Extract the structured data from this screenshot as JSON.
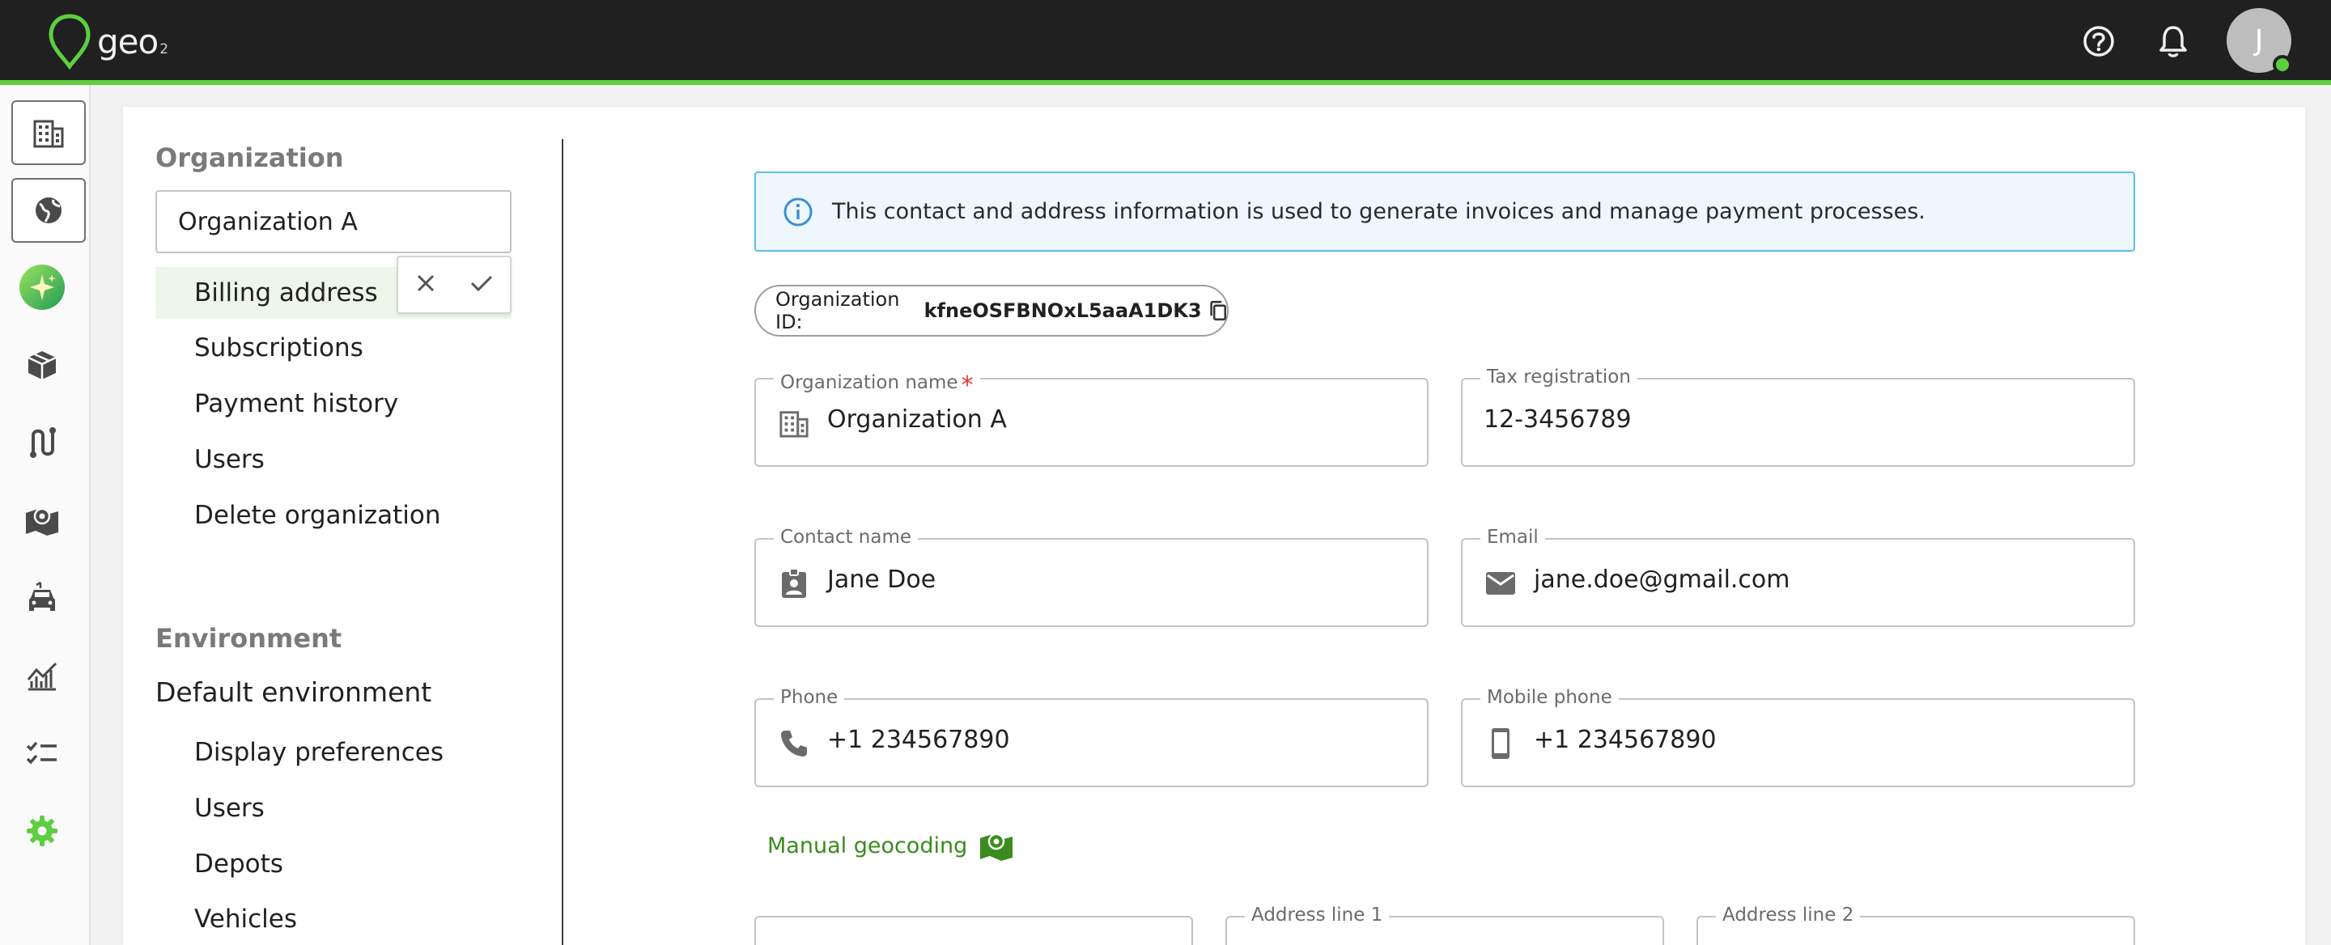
{
  "app": {
    "logo_text": "geo",
    "logo_sub": "2",
    "user_initial": "J"
  },
  "icons": {
    "help": "help-circle-icon",
    "notifications": "bell-icon"
  },
  "sidebar_rail": [
    "building-icon",
    "globe-icon",
    "sparkle-icon",
    "box-icon",
    "route-icon",
    "map-marker-icon",
    "car-icon",
    "analytics-icon",
    "checklist-icon",
    "gear-icon"
  ],
  "settings_nav": {
    "organization_heading": "Organization",
    "organization_select": "Organization A",
    "org_items": [
      "Billing address",
      "Subscriptions",
      "Payment history",
      "Users",
      "Delete organization"
    ],
    "environment_heading": "Environment",
    "environment_name": "Default environment",
    "env_items": [
      "Display preferences",
      "Users",
      "Depots",
      "Vehicles"
    ]
  },
  "content": {
    "info_banner": "This contact and address information is used to generate invoices and manage payment processes.",
    "org_id_label": "Organization ID:",
    "org_id_value": "kfneOSFBNOxL5aaA1DK3",
    "fields": {
      "org_name_label": "Organization name",
      "org_name_value": "Organization A",
      "tax_label": "Tax registration",
      "tax_value": "12-3456789",
      "contact_label": "Contact name",
      "contact_value": "Jane Doe",
      "email_label": "Email",
      "email_value": "jane.doe@gmail.com",
      "phone_label": "Phone",
      "phone_value": "+1 234567890",
      "mobile_label": "Mobile phone",
      "mobile_value": "+1 234567890"
    },
    "manual_geocoding": "Manual geocoding",
    "address_line1_label": "Address line 1",
    "address_line2_label": "Address line 2"
  },
  "colors": {
    "accent": "#5ccf3f",
    "link": "#3a8c1e",
    "info_border": "#5bbfe9",
    "required": "#e53935"
  }
}
